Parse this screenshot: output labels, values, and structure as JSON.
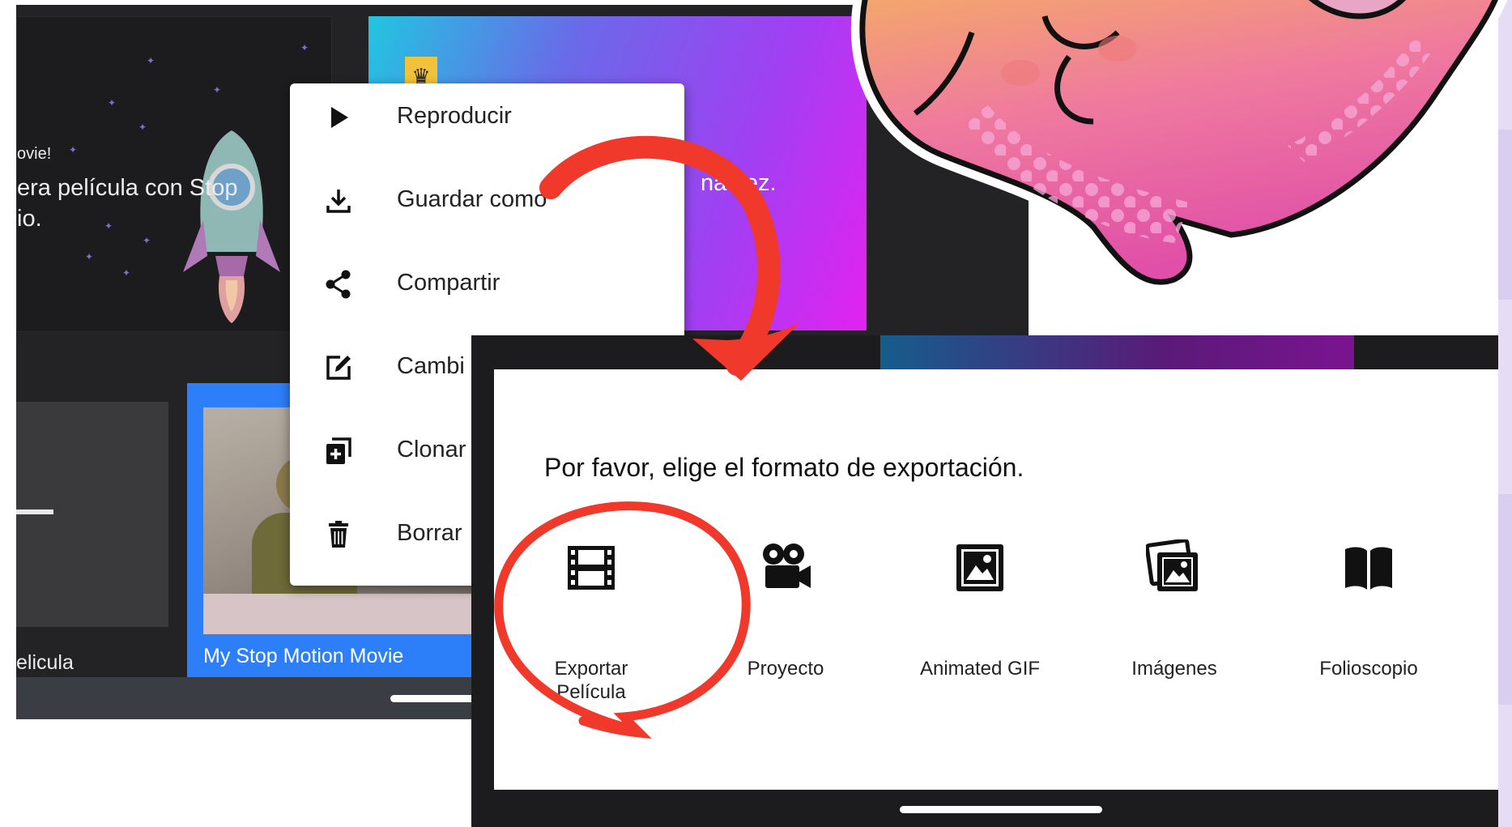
{
  "screen_left": {
    "banner_left": {
      "partial_small": "ovie!",
      "partial_line1": "era película con Stop",
      "partial_line2": "io."
    },
    "banner_right": {
      "badge_icon": "crown-icon",
      "partial_text": "na vez."
    },
    "thumb_label_left": "elicula",
    "project_card_title": "My Stop Motion Movie"
  },
  "context_menu": {
    "items": [
      {
        "icon": "play-icon",
        "label": "Reproducir"
      },
      {
        "icon": "download-icon",
        "label": "Guardar como"
      },
      {
        "icon": "share-icon",
        "label": "Compartir"
      },
      {
        "icon": "edit-icon",
        "label": "Cambi"
      },
      {
        "icon": "clone-icon",
        "label": "Clonar"
      },
      {
        "icon": "trash-icon",
        "label": "Borrar"
      }
    ]
  },
  "export_dialog": {
    "title": "Por favor, elige el formato de exportación.",
    "options": [
      {
        "icon": "film-icon",
        "label_line1": "Exportar",
        "label_line2": "Película"
      },
      {
        "icon": "movie-camera-icon",
        "label_line1": "Proyecto",
        "label_line2": ""
      },
      {
        "icon": "image-icon",
        "label_line1": "Animated GIF",
        "label_line2": ""
      },
      {
        "icon": "images-icon",
        "label_line1": "Imágenes",
        "label_line2": ""
      },
      {
        "icon": "book-icon",
        "label_line1": "Folioscopio",
        "label_line2": ""
      }
    ]
  },
  "colors": {
    "annotation_red": "#f0392b",
    "card_blue": "#2d7ff9",
    "dark_bg": "#232325"
  }
}
